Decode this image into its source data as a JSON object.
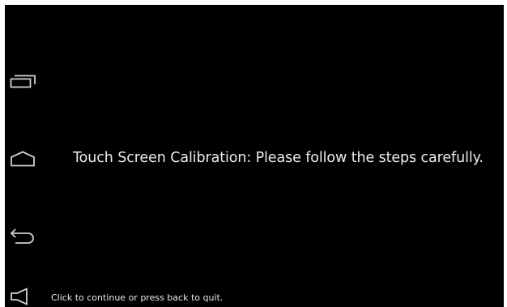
{
  "navigation": {
    "buttons": [
      {
        "id": "recents",
        "icon": "recent-apps-icon"
      },
      {
        "id": "home",
        "icon": "home-icon"
      },
      {
        "id": "back",
        "icon": "back-icon"
      },
      {
        "id": "volume",
        "icon": "volume-icon"
      }
    ]
  },
  "calibration": {
    "message": "Touch Screen Calibration: Please follow the steps carefully.",
    "hint": "Click to continue or press back to quit."
  },
  "colors": {
    "background": "#000000",
    "icon": "#d0d0d0",
    "text": "#ececec"
  }
}
